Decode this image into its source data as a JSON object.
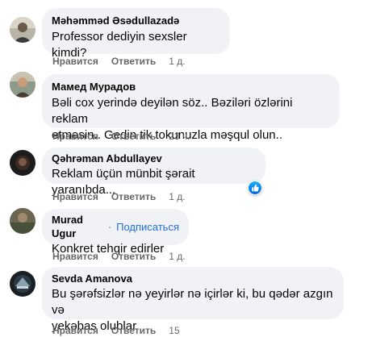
{
  "comments": [
    {
      "author": "Məhəmməd Əsədullazadə",
      "text": "Professor dediyin sexsler kimdi?",
      "like_label": "Нравится",
      "reply_label": "Ответить",
      "time": "1 д."
    },
    {
      "author": "Мамед Мурадов",
      "text_line1": "Bəli cox yerində deyilən söz.. Bəziləri özlərini reklam",
      "text_line2": "etməsin.. Gedin tik tokunuzla məşqul olun..",
      "like_label": "Нравится",
      "reply_label": "Ответить",
      "time": "23 ч."
    },
    {
      "author": "Qəhrəman Abdullayev",
      "text": "Reklam üçün münbit şərait yaranıbda...",
      "like_label": "Нравится",
      "reply_label": "Ответить",
      "time": "1 д.",
      "reaction_icon": "like-icon"
    },
    {
      "author": "Murad Ugur",
      "separator": "·",
      "follow_label": "Подписаться",
      "text": "Konkret tehqir edirler",
      "like_label": "Нравится",
      "reply_label": "Ответить",
      "time": "1 д."
    },
    {
      "author": "Sevda Amanova",
      "text_line1": "Bu şərəfsizlər nə yeyirlər nə içirlər ki, bu qədər azgın və",
      "text_line2": "yekəbas olublar",
      "like_label": "Нравится",
      "reply_label": "Ответить",
      "time": "15"
    }
  ],
  "colors": {
    "bubble": "#f0f2f5",
    "meta_text": "#65676b",
    "link": "#216fdb",
    "like_blue": "#0866ff"
  }
}
